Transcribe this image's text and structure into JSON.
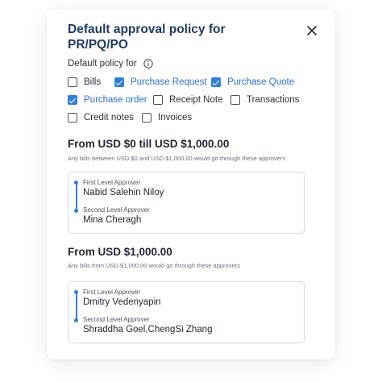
{
  "dialog": {
    "title": "Default approval policy for PR/PQ/PO",
    "default_policy_label": "Default policy for",
    "accent_color": "#2f7fd6"
  },
  "checkboxes": [
    {
      "label": "Bills",
      "checked": false
    },
    {
      "label": "Purchase Request",
      "checked": true
    },
    {
      "label": "Purchase Quote",
      "checked": true
    },
    {
      "label": "Purchase order",
      "checked": true
    },
    {
      "label": "Receipt Note",
      "checked": false
    },
    {
      "label": "Transactions",
      "checked": false
    },
    {
      "label": "Credit notes",
      "checked": false
    },
    {
      "label": "Invoices",
      "checked": false
    }
  ],
  "sections": [
    {
      "title": "From USD $0 till USD $1,000.00",
      "subtitle": "Any bills between USD $0 and USD $1,000.00 would go through  these approvers",
      "first_label": "First Level Approver",
      "first_name": "Nabid Salehin Niloy",
      "second_label": "Second Level Approver",
      "second_name": "Mina Cheragh"
    },
    {
      "title": "From USD $1,000.00",
      "subtitle": "Any bills from USD $1,000.00 would go through these approvers",
      "first_label": "First Level Approver",
      "first_name": "Dmitry Vedenyapin",
      "second_label": "Second Level Approver",
      "second_name": "Shraddha Goel,ChengSi Zhang"
    }
  ]
}
